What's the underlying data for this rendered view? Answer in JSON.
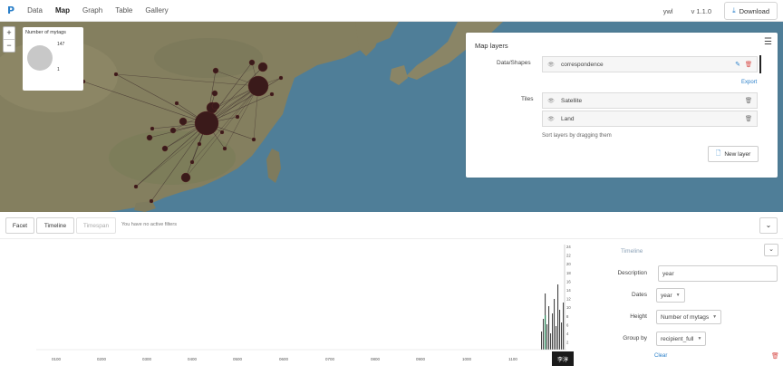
{
  "app": {
    "logo": "P",
    "nav": [
      "Data",
      "Map",
      "Graph",
      "Table",
      "Gallery"
    ],
    "active_nav": "Map",
    "user": "ywl",
    "version": "v 1.1.0",
    "download_label": "Download"
  },
  "map": {
    "zoom_in": "+",
    "zoom_out": "−",
    "legend": {
      "title": "Number of mytags",
      "max": "147",
      "min": "1"
    },
    "colors": {
      "sea": "#4f7e98",
      "land": "#8a8a66",
      "node": "#3a1a1a"
    }
  },
  "layers_panel": {
    "title": "Map layers",
    "data_label": "Data/Shapes",
    "data_layers": [
      {
        "name": "correspondence"
      }
    ],
    "export_label": "Export",
    "tiles_label": "Tiles",
    "tile_layers": [
      {
        "name": "Satellite"
      },
      {
        "name": "Land"
      }
    ],
    "sort_hint": "Sort layers by dragging them",
    "new_layer_label": "New layer"
  },
  "filterbar": {
    "facet_label": "Facet",
    "timeline_label": "Timeline",
    "timespan_label": "Timespan",
    "note": "You have no active filters"
  },
  "timeline": {
    "panel_title": "Timeline",
    "description_label": "Description",
    "description_value": "year",
    "dates_label": "Dates",
    "dates_value": "year",
    "height_label": "Height",
    "height_value": "Number of mytags",
    "groupby_label": "Group by",
    "groupby_value": "recipient_full",
    "clear_label": "Clear",
    "x_ticks": [
      "0100",
      "0200",
      "0300",
      "0400",
      "0500",
      "0600",
      "0700",
      "0800",
      "0900",
      "1000",
      "1100"
    ],
    "y_ticks": [
      "24",
      "22",
      "20",
      "18",
      "16",
      "14",
      "12",
      "10",
      "8",
      "6",
      "4",
      "2"
    ],
    "tooltip_label": "李淳"
  }
}
